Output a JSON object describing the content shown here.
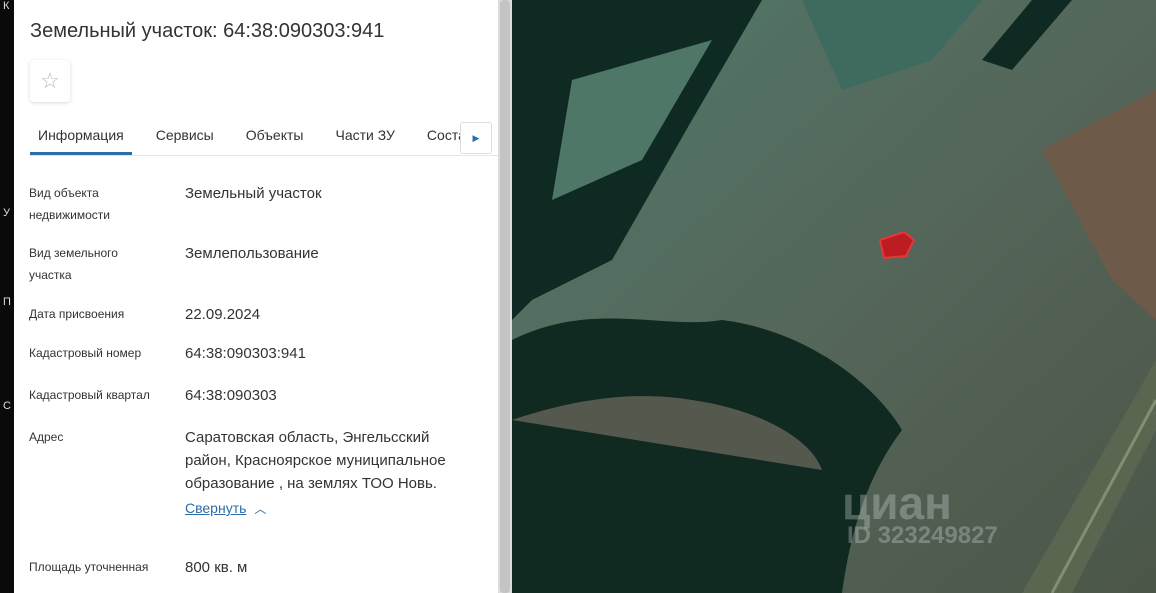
{
  "left_strip": [
    "К",
    "У",
    "П",
    "С"
  ],
  "title": "Земельный участок: 64:38:090303:941",
  "favorite_icon": "star-outline",
  "tabs": [
    {
      "label": "Информация",
      "active": true
    },
    {
      "label": "Сервисы"
    },
    {
      "label": "Объекты"
    },
    {
      "label": "Части ЗУ"
    },
    {
      "label": "Соста"
    }
  ],
  "tabs_next_icon": "triangle-right",
  "fields": [
    {
      "label": "Вид объекта недвижимости",
      "value": "Земельный участок"
    },
    {
      "label": "Вид земельного участка",
      "value": "Землепользование"
    },
    {
      "label": "Дата присвоения",
      "value": "22.09.2024"
    },
    {
      "label": "Кадастровый номер",
      "value": "64:38:090303:941"
    },
    {
      "label": "Кадастровый квартал",
      "value": "64:38:090303"
    },
    {
      "label": "Адрес",
      "value": "Саратовская область, Энгельсский район, Красноярское муниципальное образование , на землях ТОО Новь."
    },
    {
      "label": "Площадь уточненная",
      "value": "800 кв. м"
    }
  ],
  "collapse_link": "Свернуть",
  "map": {
    "parcel_color": "#d0101a",
    "watermark": "циан",
    "watermark_id": "ID 323249827"
  }
}
